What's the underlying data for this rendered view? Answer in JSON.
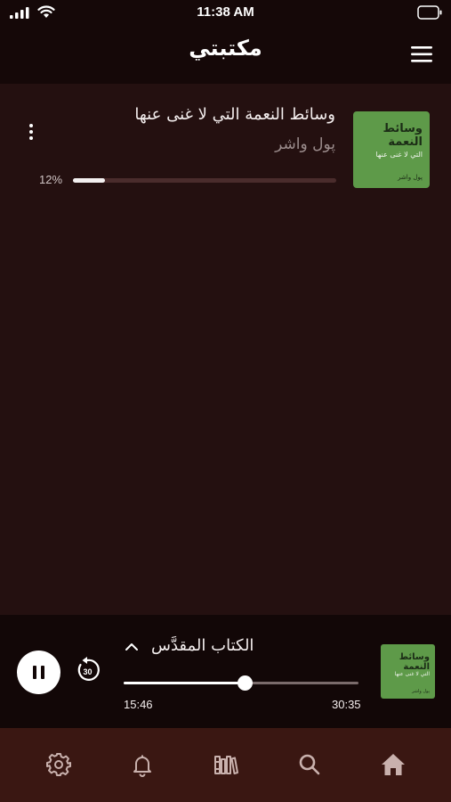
{
  "status_bar": {
    "time": "11:38 AM"
  },
  "header": {
    "title": "مكتبتي",
    "menu_icon": "hamburger-menu-icon"
  },
  "library": {
    "books": [
      {
        "title": "وسائط النعمة التي لا غنى عنها",
        "author": "پول واشر",
        "progress_label": "12%",
        "progress": 0.12,
        "cover": {
          "title": "وسائط النعمة",
          "subtitle": "التي لا غنى عنها",
          "author": "پول واشر",
          "color": "#5e9a49"
        }
      }
    ]
  },
  "now_playing": {
    "title": "الكتاب المقدَّس",
    "elapsed": "15:46",
    "total": "30:35",
    "progress": 0.515,
    "rewind_seconds": "30",
    "cover": {
      "title": "وسائط النعمة",
      "subtitle": "التي لا غنى عنها",
      "author": "پول واشر"
    }
  },
  "tab_bar": {
    "tabs": [
      {
        "name": "settings",
        "icon": "gear-icon"
      },
      {
        "name": "notifications",
        "icon": "bell-icon"
      },
      {
        "name": "library",
        "icon": "library-icon",
        "active": true
      },
      {
        "name": "search",
        "icon": "search-icon"
      },
      {
        "name": "home",
        "icon": "home-icon"
      }
    ]
  },
  "colors": {
    "background": "#241010",
    "header": "#150808",
    "player": "#120707",
    "tab_bar": "#3a1712",
    "cover_green": "#5e9a49",
    "tab_icon": "#c9b1ad"
  }
}
